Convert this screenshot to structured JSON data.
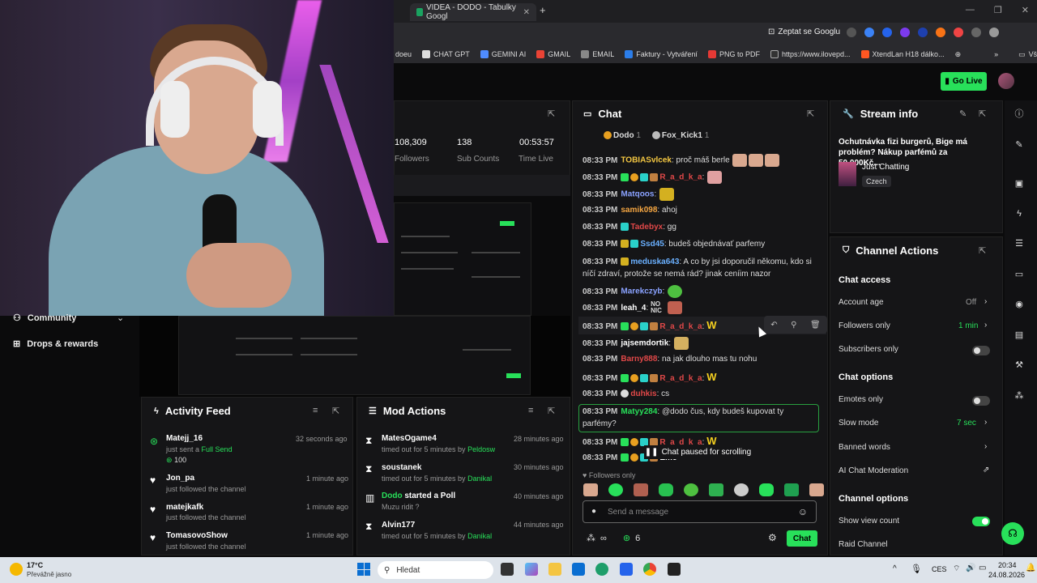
{
  "browser": {
    "tab_partial": "doeu",
    "tab_active": "VIDEA - DODO - Tabulky Googl",
    "ask_google": "Zeptat se Googlu",
    "bookmarks": [
      "doeu",
      "CHAT GPT",
      "GEMINI AI",
      "GMAIL",
      "EMAIL",
      "Faktury - Vytváření",
      "PNG to PDF",
      "https://www.ilovepd...",
      "XtendLan H18 dálko..."
    ],
    "all_bookmarks": "Všechny záložky",
    "more": "»"
  },
  "header": {
    "go_live": "Go Live"
  },
  "nav": {
    "community": "Community",
    "drops": "Drops & rewards"
  },
  "stats": [
    {
      "value": "108,309",
      "label": "Followers"
    },
    {
      "value": "138",
      "label": "Sub Counts"
    },
    {
      "value": "00:53:57",
      "label": "Time Live"
    }
  ],
  "chat": {
    "title": "Chat",
    "pinned": [
      {
        "name": "Dodo",
        "count": "1"
      },
      {
        "name": "Fox_Kick1",
        "count": "1"
      }
    ],
    "messages": [
      {
        "time": "08:33 PM",
        "user": "TOBIASvlcek",
        "color": "#f5c842",
        "text": "proč máš berle"
      },
      {
        "time": "08:33 PM",
        "user": "R_a_d_k_a",
        "color": "#e04848",
        "text": ""
      },
      {
        "time": "08:33 PM",
        "user": "Matqoos",
        "color": "#8aa2ff",
        "text": ""
      },
      {
        "time": "08:33 PM",
        "user": "samik098",
        "color": "#f5a642",
        "text": "ahoj"
      },
      {
        "time": "08:33 PM",
        "user": "Tadebyx",
        "color": "#e04848",
        "text": "gg"
      },
      {
        "time": "08:33 PM",
        "user": "Ssd45",
        "color": "#6ab0ff",
        "text": "budeš objednávať parfemy"
      },
      {
        "time": "08:33 PM",
        "user": "meduska643",
        "color": "#6ab0ff",
        "text": "A co by jsi doporučil někomu, kdo si"
      },
      {
        "time": "",
        "user": "",
        "color": "#ddd",
        "text": "níčí zdraví, protože se nemá rád? jinak ceníim nazor"
      },
      {
        "time": "08:33 PM",
        "user": "Marekczyb",
        "color": "#8aa2ff",
        "text": ""
      },
      {
        "time": "08:33 PM",
        "user": "leah_4",
        "color": "#ffffff",
        "text": ""
      },
      {
        "time": "08:33 PM",
        "user": "R_a_d_k_a",
        "color": "#e04848",
        "text": ""
      },
      {
        "time": "08:33 PM",
        "user": "jajsemdortik",
        "color": "#ffffff",
        "text": ""
      },
      {
        "time": "08:33 PM",
        "user": "Barny888",
        "color": "#e04848",
        "text": "na jak dlouho mas tu nohu"
      },
      {
        "time": "08:33 PM",
        "user": "R_a_d_k_a",
        "color": "#e04848",
        "text": ""
      },
      {
        "time": "08:33 PM",
        "user": "duhkis",
        "color": "#e04848",
        "text": "cs"
      },
      {
        "time": "08:33 PM",
        "user": "Matyy284",
        "color": "#28e05a",
        "text": "@dodo čus, kdy budeš kupovat ty"
      },
      {
        "time": "",
        "user": "",
        "color": "#ddd",
        "text": "parfémy?"
      },
      {
        "time": "08:33 PM",
        "user": "R_a_d_k_a",
        "color": "#e04848",
        "text": ""
      },
      {
        "time": "08:33 PM",
        "user": "Emc",
        "color": "#ffffff",
        "text": ""
      }
    ],
    "emote_text_noc": "NO NIC",
    "emote_w": "W",
    "paused": "Chat paused for scrolling",
    "followers_only": "Followers only",
    "input_placeholder": "Send a message",
    "infinity": "∞",
    "points": "6",
    "send": "Chat"
  },
  "stream_info": {
    "title": "Stream info",
    "stream_title": "Ochutnávka fizi burgerů, Bige má problém? Nákup parfémů za 50,000Kč...",
    "category": "Just Chatting",
    "tag": "Czech"
  },
  "channel_actions": {
    "title": "Channel Actions",
    "chat_access": "Chat access",
    "account_age": "Account age",
    "account_age_val": "Off",
    "followers_only": "Followers only",
    "followers_only_val": "1 min",
    "subscribers_only": "Subscribers only",
    "chat_options": "Chat options",
    "emotes_only": "Emotes only",
    "slow_mode": "Slow mode",
    "slow_mode_val": "7 sec",
    "banned_words": "Banned words",
    "ai_moderation": "AI Chat Moderation",
    "channel_options": "Channel options",
    "show_view_count": "Show view count",
    "raid_channel": "Raid Channel"
  },
  "activity": {
    "title": "Activity Feed",
    "items": [
      {
        "user": "Matejj_16",
        "action": "just sent a",
        "highlight": "Full Send",
        "amount": "100",
        "time": "32 seconds ago"
      },
      {
        "user": "Jon_pa",
        "action": "just followed the channel",
        "time": "1 minute ago"
      },
      {
        "user": "matejkafk",
        "action": "just followed the channel",
        "time": "1 minute ago"
      },
      {
        "user": "TomasovoShow",
        "action": "just followed the channel",
        "time": "1 minute ago"
      }
    ]
  },
  "mod": {
    "title": "Mod Actions",
    "items": [
      {
        "user": "MatesOgame4",
        "action": "timed out for 5 minutes by",
        "by": "Peldosw",
        "time": "28 minutes ago"
      },
      {
        "user": "soustanek",
        "action": "timed out for 5 minutes by",
        "by": "Danikal",
        "time": "30 minutes ago"
      },
      {
        "user": "Dodo",
        "action": "started a Poll",
        "sub": "Muzu ridit ?",
        "time": "40 minutes ago"
      },
      {
        "user": "Alvin177",
        "action": "timed out for 5 minutes by",
        "by": "Danikal",
        "time": "44 minutes ago"
      }
    ]
  },
  "taskbar": {
    "weather_temp": "17°C",
    "weather_desc": "Převážně jasno",
    "search": "Hledat",
    "lang": "CES",
    "time": "20:34",
    "date": "24.08.2026"
  },
  "colors": {
    "accent": "#28e05a",
    "panel": "#151517",
    "bg": "#0b0b0c"
  }
}
